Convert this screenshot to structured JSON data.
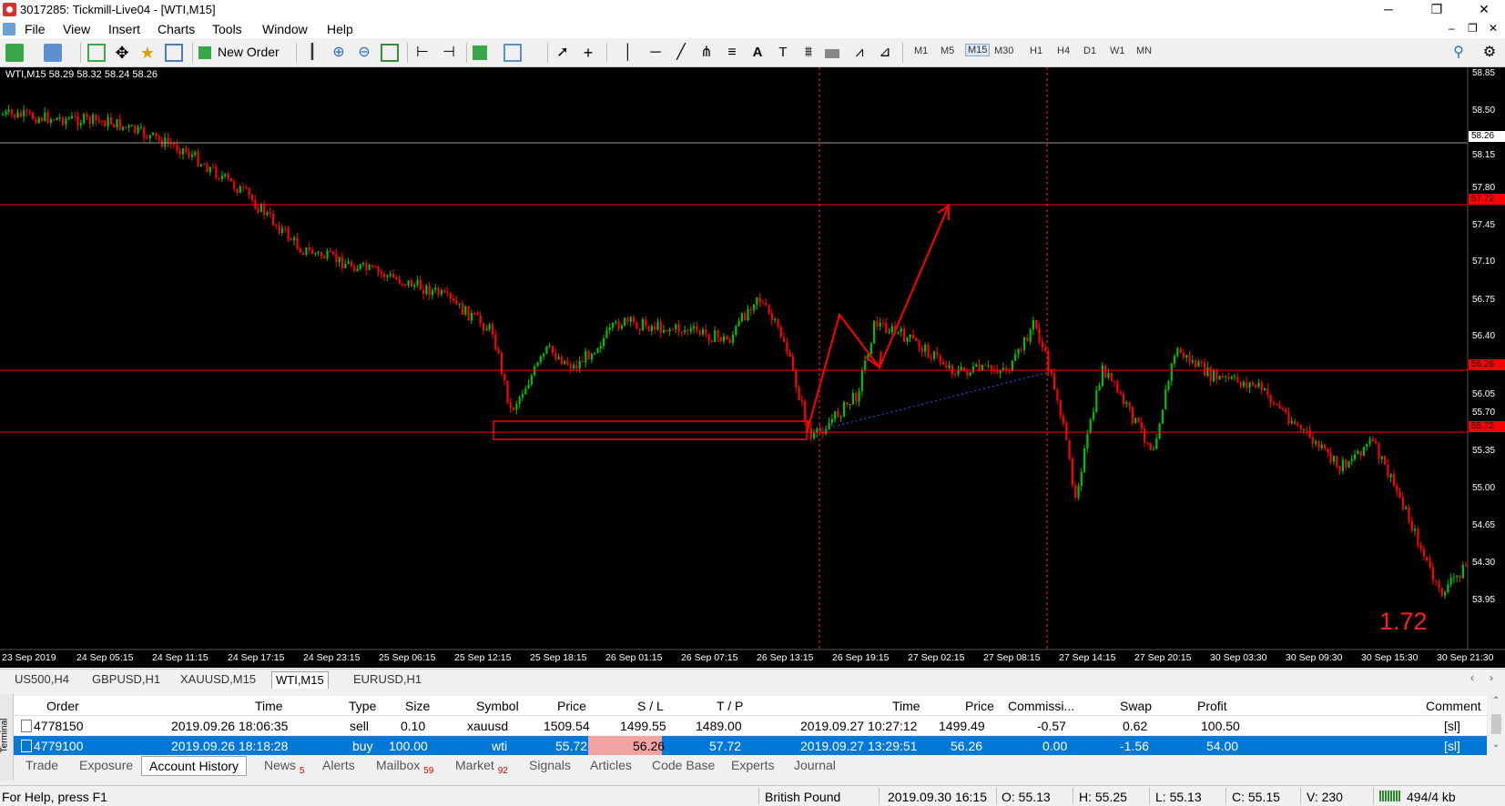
{
  "window": {
    "title": "3017285: Tickmill-Live04 - [WTI,M15]",
    "controls": {
      "minimize": "─",
      "restore": "❐",
      "close": "✕"
    }
  },
  "menu": [
    "File",
    "View",
    "Insert",
    "Charts",
    "Tools",
    "Window",
    "Help"
  ],
  "toolbar": {
    "new_order": "New Order",
    "timeframes": [
      "M1",
      "M5",
      "M15",
      "M30",
      "H1",
      "H4",
      "D1",
      "W1",
      "MN"
    ],
    "active_timeframe": "M15"
  },
  "chart": {
    "info": "WTI,M15  58.29 58.32 58.24 58.26",
    "price_ticks": [
      "58.85",
      "58.50",
      "58.15",
      "57.80",
      "57.45",
      "57.10",
      "56.75",
      "56.40",
      "56.05",
      "55.70",
      "55.35",
      "55.00",
      "54.65",
      "54.30",
      "53.95"
    ],
    "current_price": "58.26",
    "levels": [
      "57.72",
      "56.26",
      "55.72"
    ],
    "time_ticks": [
      "23 Sep 2019",
      "24 Sep 05:15",
      "24 Sep 11:15",
      "24 Sep 17:15",
      "24 Sep 23:15",
      "25 Sep 06:15",
      "25 Sep 12:15",
      "25 Sep 18:15",
      "26 Sep 01:15",
      "26 Sep 07:15",
      "26 Sep 13:15",
      "26 Sep 19:15",
      "27 Sep 02:15",
      "27 Sep 08:15",
      "27 Sep 14:15",
      "27 Sep 20:15",
      "30 Sep 03:30",
      "30 Sep 09:30",
      "30 Sep 15:30",
      "30 Sep 21:30"
    ],
    "annotation": "1.72",
    "colors": {
      "background": "#000000",
      "bull": "#00c000",
      "bear": "#ff0000",
      "line": "#ff0000"
    }
  },
  "symbol_tabs": [
    "US500,H4",
    "GBPUSD,H1",
    "XAUUSD,M15",
    "WTI,M15",
    "EURUSD,H1"
  ],
  "active_symbol_tab": "WTI,M15",
  "terminal": {
    "side_label": "Terminal",
    "columns": [
      "Order",
      "Time",
      "Type",
      "Size",
      "Symbol",
      "Price",
      "S / L",
      "T / P",
      "Time",
      "Price",
      "Commissi...",
      "Swap",
      "Profit",
      "Comment"
    ],
    "rows": [
      {
        "order": "4778150",
        "time": "2019.09.26 18:06:35",
        "type": "sell",
        "size": "0.10",
        "symbol": "xauusd",
        "price": "1509.54",
        "sl": "1499.55",
        "tp": "1489.00",
        "close_time": "2019.09.27 10:27:12",
        "close_price": "1499.49",
        "commission": "-0.57",
        "swap": "0.62",
        "profit": "100.50",
        "comment": "[sl]"
      },
      {
        "order": "4779100",
        "time": "2019.09.26 18:18:28",
        "type": "buy",
        "size": "100.00",
        "symbol": "wti",
        "price": "55.72",
        "sl": "56.26",
        "tp": "57.72",
        "close_time": "2019.09.27 13:29:51",
        "close_price": "56.26",
        "commission": "0.00",
        "swap": "-1.56",
        "profit": "54.00",
        "comment": "[sl]"
      }
    ],
    "tabs": [
      {
        "label": "Trade",
        "badge": ""
      },
      {
        "label": "Exposure",
        "badge": ""
      },
      {
        "label": "Account History",
        "badge": ""
      },
      {
        "label": "News",
        "badge": "5"
      },
      {
        "label": "Alerts",
        "badge": ""
      },
      {
        "label": "Mailbox",
        "badge": "59"
      },
      {
        "label": "Market",
        "badge": "92"
      },
      {
        "label": "Signals",
        "badge": ""
      },
      {
        "label": "Articles",
        "badge": ""
      },
      {
        "label": "Code Base",
        "badge": ""
      },
      {
        "label": "Experts",
        "badge": ""
      },
      {
        "label": "Journal",
        "badge": ""
      }
    ],
    "active_tab": "Account History"
  },
  "status": {
    "help": "For Help, press F1",
    "profile": "British Pound",
    "datetime": "2019.09.30 16:15",
    "open": "O: 55.13",
    "high": "H: 55.25",
    "low": "L: 55.13",
    "close": "C: 55.15",
    "volume": "V: 230",
    "traffic": "494/4 kb"
  }
}
